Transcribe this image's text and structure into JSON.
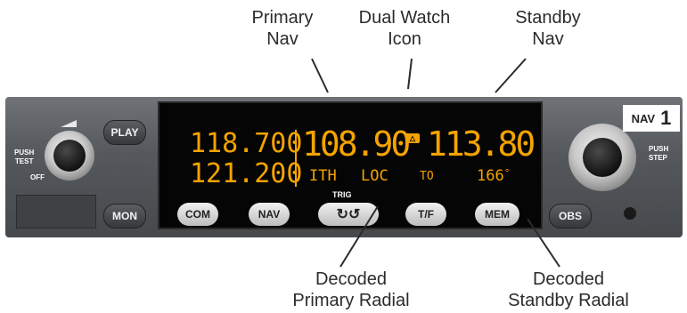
{
  "callouts": {
    "primary_nav": [
      "Primary",
      "Nav"
    ],
    "dual_watch": [
      "Dual Watch",
      "Icon"
    ],
    "standby_nav": [
      "Standby",
      "Nav"
    ],
    "decoded_primary": [
      "Decoded",
      "Primary Radial"
    ],
    "decoded_standby": [
      "Decoded",
      "Standby Radial"
    ]
  },
  "panel": {
    "push_test": [
      "PUSH",
      "TEST"
    ],
    "off": "OFF",
    "push_step": [
      "PUSH",
      "STEP"
    ],
    "nav_label": "NAV",
    "nav_number": "1",
    "brand": "TRIG"
  },
  "buttons": {
    "play": "PLAY",
    "mon": "MON",
    "com": "COM",
    "nav": "NAV",
    "swap_icon": "swap-arrows-icon",
    "tf": "T/F",
    "mem": "MEM",
    "obs": "OBS"
  },
  "display": {
    "com_active": "118.700",
    "com_standby": "121.200",
    "nav_primary": "108.90",
    "nav_standby": "113.80",
    "primary_id": "ITH",
    "primary_mode": "LOC",
    "to_from": "TO",
    "standby_radial": "166",
    "degree": "°"
  },
  "colors": {
    "display_amber": "#f5a300",
    "panel": "#55595d"
  }
}
